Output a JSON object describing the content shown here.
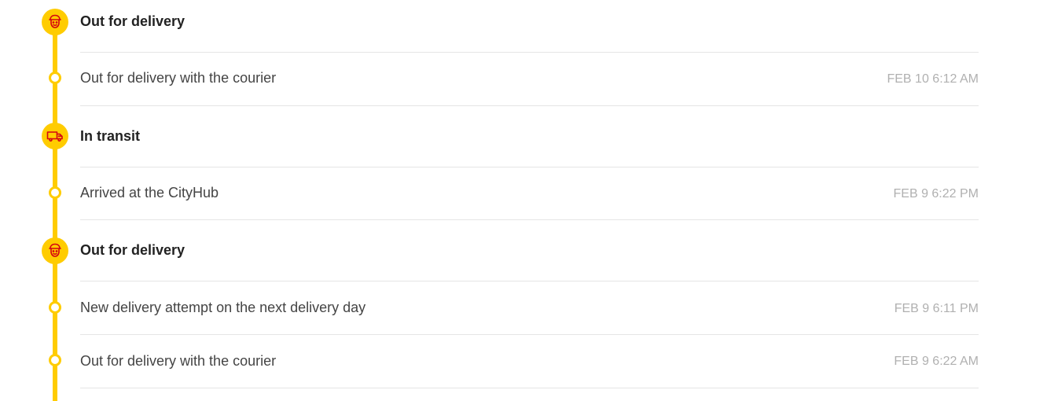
{
  "colors": {
    "rail": "#ffcc00",
    "icon_bg": "#ffcc00",
    "icon_stroke": "#d40511",
    "divider": "#e5e5e5",
    "time_text": "#b0b0b0"
  },
  "groups": [
    {
      "icon": "courier-icon",
      "title": "Out for delivery",
      "events": [
        {
          "text": "Out for delivery with the courier",
          "time": "FEB 10 6:12 AM"
        }
      ]
    },
    {
      "icon": "truck-icon",
      "title": "In transit",
      "events": [
        {
          "text": "Arrived at the CityHub",
          "time": "FEB 9 6:22 PM"
        }
      ]
    },
    {
      "icon": "courier-icon",
      "title": "Out for delivery",
      "events": [
        {
          "text": "New delivery attempt on the next delivery day",
          "time": "FEB 9 6:11 PM"
        },
        {
          "text": "Out for delivery with the courier",
          "time": "FEB 9 6:22 AM"
        }
      ]
    }
  ]
}
